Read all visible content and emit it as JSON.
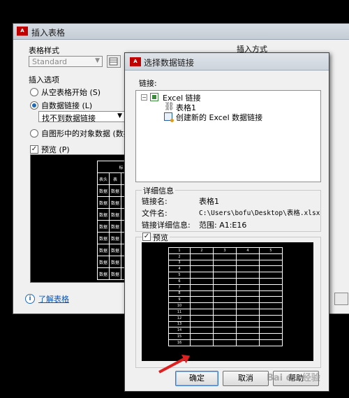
{
  "back_dialog": {
    "title": "插入表格",
    "table_style_label": "表格样式",
    "table_style_value": "Standard",
    "insert_method_label": "插入方式",
    "insert_options_label": "插入选项",
    "options": [
      "从空表格开始 (S)",
      "自数据链接 (L)",
      "自图形中的对象数据 (数据"
    ],
    "selected_option": "自数据链接 (L)",
    "data_link_value": "找不到数据链接",
    "preview_label": "预览 (P)",
    "preview_title_fragment": "标",
    "preview_header_cells": [
      "表头",
      "表"
    ],
    "preview_data_cell": "数据",
    "help_link": "了解表格"
  },
  "front_dialog": {
    "title": "选择数据链接",
    "links_label": "链接:",
    "tree": {
      "root": "Excel 链接",
      "child": "表格1",
      "create_new": "创建新的 Excel 数据链接"
    },
    "details": {
      "group_label": "详细信息",
      "link_name_label": "链接名:",
      "link_name_value": "表格1",
      "file_name_label": "文件名:",
      "file_name_value": "C:\\Users\\bofu\\Desktop\\表格.xlsx",
      "link_details_label": "链接详细信息:",
      "link_details_value": "范围: A1:E16"
    },
    "preview_label": "预览",
    "preview_columns": [
      "1",
      "2",
      "3",
      "4",
      "5"
    ],
    "preview_rows": [
      "2",
      "3",
      "4",
      "5",
      "6",
      "7",
      "8",
      "9",
      "10",
      "11",
      "12",
      "13",
      "14",
      "15",
      "16"
    ],
    "buttons": {
      "ok": "确定",
      "cancel": "取消",
      "help": "帮助"
    }
  },
  "watermark_text": "Bai du 经验"
}
